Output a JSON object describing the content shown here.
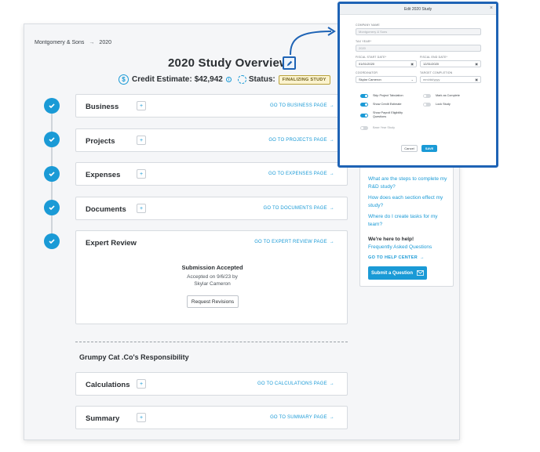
{
  "breadcrumb": {
    "company": "Montgomery & Sons",
    "separator": "→",
    "year": "2020"
  },
  "header": {
    "title": "2020 Study Overview",
    "credit_estimate_label": "Credit Estimate:",
    "credit_estimate_value": "$42,942",
    "status_label": "Status:",
    "status_value": "FINALIZING STUDY",
    "dollar_glyph": "$",
    "info_glyph": "i"
  },
  "sections": [
    {
      "label": "Business",
      "goto": "GO TO BUSINESS PAGE"
    },
    {
      "label": "Projects",
      "goto": "GO TO PROJECTS PAGE"
    },
    {
      "label": "Expenses",
      "goto": "GO TO EXPENSES PAGE"
    },
    {
      "label": "Documents",
      "goto": "GO TO DOCUMENTS PAGE"
    },
    {
      "label": "Expert Review",
      "goto": "GO TO EXPERT REVIEW PAGE"
    }
  ],
  "plus_glyph": "+",
  "arrow_glyph": "→",
  "expert_review": {
    "accepted_title": "Submission Accepted",
    "accepted_line1": "Accepted on 9/6/23 by",
    "accepted_line2": "Skylar Cameron",
    "request_revisions": "Request Revisions"
  },
  "responsibility": {
    "title": "Grumpy Cat .Co's Responsibility",
    "sections": [
      {
        "label": "Calculations",
        "goto": "GO TO CALCULATIONS PAGE"
      },
      {
        "label": "Summary",
        "goto": "GO TO SUMMARY PAGE"
      }
    ]
  },
  "help_panel": {
    "faqs": [
      "What are the steps to complete my R&D study?",
      "How does each section effect my study?",
      "Where do I create tasks for my team?"
    ],
    "help_title": "We're here to help!",
    "faq_link": "Frequently Asked Questions",
    "help_center": "GO TO HELP CENTER",
    "submit_question": "Submit a Question"
  },
  "modal": {
    "title": "Edit 2020 Study",
    "close": "×",
    "company_name_label": "COMPANY NAME",
    "company_name_value": "Montgomery & Sons",
    "tax_year_label": "TAX YEAR*",
    "tax_year_value": "2020",
    "fiscal_start_label": "FISCAL START DATE*",
    "fiscal_start_value": "01/01/2020",
    "fiscal_end_label": "FISCAL END DATE*",
    "fiscal_end_value": "12/31/2020",
    "coordinator_label": "COORDINATOR",
    "coordinator_value": "Skylar Cameron",
    "target_completion_label": "TARGET COMPLETION",
    "target_completion_placeholder": "mm/dd/yyyy",
    "toggles": {
      "skip_project_tabulation": "Skip Project Tabulation",
      "mark_as_complete": "Mark as Complete",
      "show_credit_estimate": "Show Credit Estimate",
      "lock_study": "Lock Study",
      "show_payroll_line1": "Show Payroll Eligibility",
      "show_payroll_line2": "Questions",
      "base_year_study": "Base Year Study"
    },
    "cancel": "Cancel",
    "save": "SAVE"
  },
  "colors": {
    "accent": "#1a9ad6",
    "highlight_border": "#1e63b5",
    "status_bg": "#fbf3cf"
  }
}
